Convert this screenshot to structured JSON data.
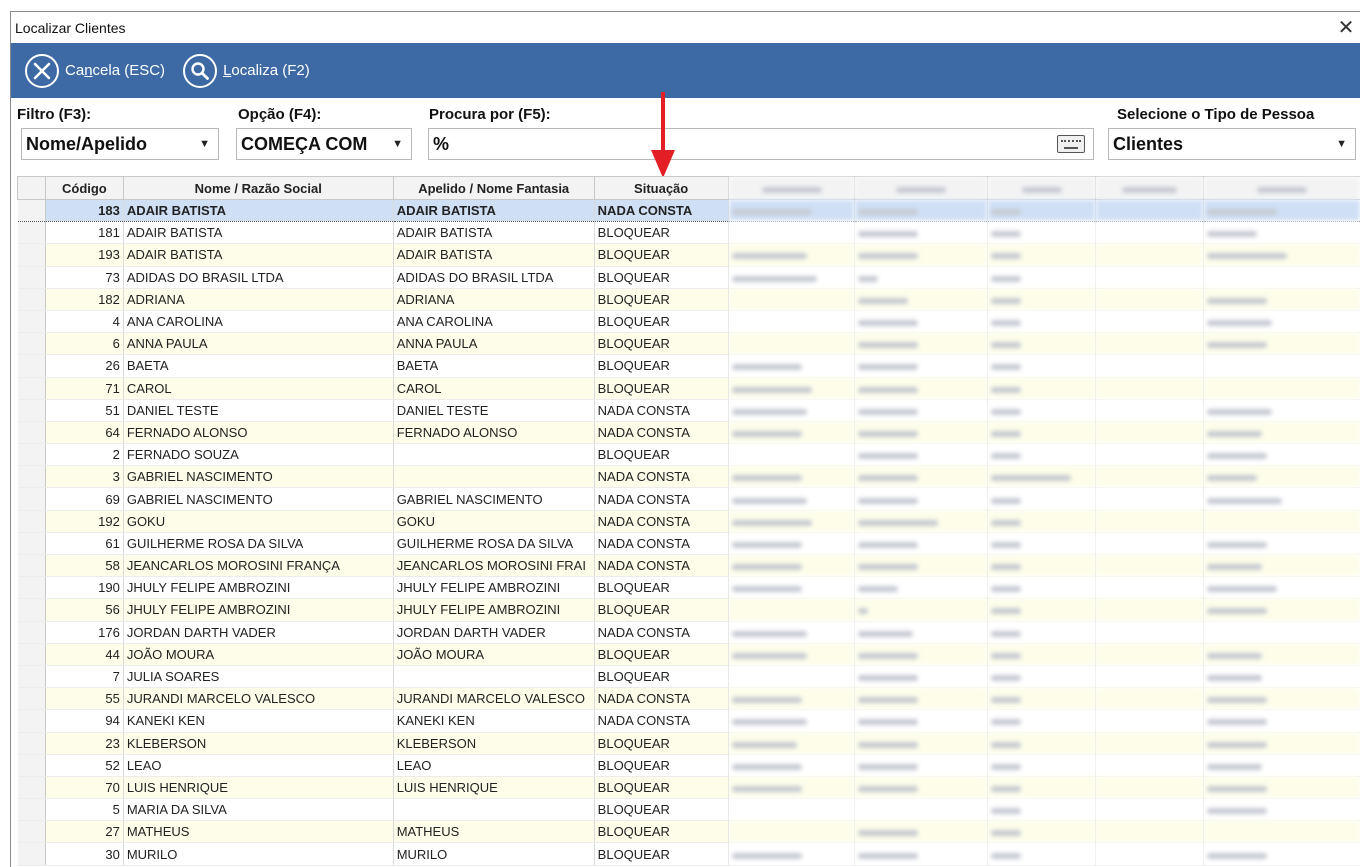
{
  "window": {
    "title": "Localizar Clientes",
    "close_symbol": "✕"
  },
  "toolbar": {
    "cancel": {
      "pre": "Ca",
      "ul": "n",
      "post": "cela (ESC)"
    },
    "search": {
      "pre": "",
      "ul": "L",
      "post": "ocaliza (F2)"
    }
  },
  "filters": {
    "filtro_label": "Filtro (F3):",
    "filtro_value": "Nome/Apelido",
    "opcao_label": "Opção (F4):",
    "opcao_value": "COMEÇA COM",
    "procura_label": "Procura por (F5):",
    "procura_value": "%",
    "tipo_label": "Selecione o Tipo de Pessoa",
    "tipo_value": "Clientes"
  },
  "grid": {
    "columns": [
      "Código",
      "Nome / Razão Social",
      "Apelido / Nome Fantasia",
      "Situação"
    ],
    "rows": [
      {
        "codigo": "183",
        "nome": "ADAIR  BATISTA",
        "apelido": "ADAIR  BATISTA",
        "situacao": "NADA CONSTA"
      },
      {
        "codigo": "181",
        "nome": "ADAIR  BATISTA",
        "apelido": "ADAIR  BATISTA",
        "situacao": "BLOQUEAR"
      },
      {
        "codigo": "193",
        "nome": "ADAIR  BATISTA",
        "apelido": "ADAIR  BATISTA",
        "situacao": "BLOQUEAR"
      },
      {
        "codigo": "73",
        "nome": "ADIDAS DO BRASIL LTDA",
        "apelido": "ADIDAS DO BRASIL LTDA",
        "situacao": "BLOQUEAR"
      },
      {
        "codigo": "182",
        "nome": "ADRIANA",
        "apelido": "ADRIANA",
        "situacao": "BLOQUEAR"
      },
      {
        "codigo": "4",
        "nome": "ANA CAROLINA",
        "apelido": "ANA CAROLINA",
        "situacao": "BLOQUEAR"
      },
      {
        "codigo": "6",
        "nome": "ANNA PAULA",
        "apelido": "ANNA PAULA",
        "situacao": "BLOQUEAR"
      },
      {
        "codigo": "26",
        "nome": "BAETA",
        "apelido": "BAETA",
        "situacao": "BLOQUEAR"
      },
      {
        "codigo": "71",
        "nome": "CAROL",
        "apelido": "CAROL",
        "situacao": "BLOQUEAR"
      },
      {
        "codigo": "51",
        "nome": "DANIEL TESTE",
        "apelido": "DANIEL TESTE",
        "situacao": "NADA CONSTA"
      },
      {
        "codigo": "64",
        "nome": "FERNADO ALONSO",
        "apelido": "FERNADO ALONSO",
        "situacao": "NADA CONSTA"
      },
      {
        "codigo": "2",
        "nome": "FERNADO SOUZA",
        "apelido": "",
        "situacao": "BLOQUEAR"
      },
      {
        "codigo": "3",
        "nome": "GABRIEL NASCIMENTO",
        "apelido": "",
        "situacao": "NADA CONSTA"
      },
      {
        "codigo": "69",
        "nome": "GABRIEL NASCIMENTO",
        "apelido": "GABRIEL NASCIMENTO",
        "situacao": "NADA CONSTA"
      },
      {
        "codigo": "192",
        "nome": "GOKU",
        "apelido": "GOKU",
        "situacao": "NADA CONSTA"
      },
      {
        "codigo": "61",
        "nome": "GUILHERME ROSA DA SILVA",
        "apelido": "GUILHERME ROSA DA SILVA",
        "situacao": "NADA CONSTA"
      },
      {
        "codigo": "58",
        "nome": "JEANCARLOS MOROSINI FRANÇA",
        "apelido": "JEANCARLOS MOROSINI FRAI",
        "situacao": "NADA CONSTA"
      },
      {
        "codigo": "190",
        "nome": "JHULY FELIPE AMBROZINI",
        "apelido": "JHULY FELIPE AMBROZINI",
        "situacao": "BLOQUEAR"
      },
      {
        "codigo": "56",
        "nome": "JHULY FELIPE AMBROZINI",
        "apelido": "JHULY FELIPE AMBROZINI",
        "situacao": "BLOQUEAR"
      },
      {
        "codigo": "176",
        "nome": "JORDAN DARTH VADER",
        "apelido": "JORDAN DARTH VADER",
        "situacao": "NADA CONSTA"
      },
      {
        "codigo": "44",
        "nome": "JOÃO MOURA",
        "apelido": "JOÃO MOURA",
        "situacao": "BLOQUEAR"
      },
      {
        "codigo": "7",
        "nome": "JULIA SOARES",
        "apelido": "",
        "situacao": "BLOQUEAR"
      },
      {
        "codigo": "55",
        "nome": "JURANDI MARCELO VALESCO",
        "apelido": "JURANDI MARCELO VALESCO",
        "situacao": "NADA CONSTA"
      },
      {
        "codigo": "94",
        "nome": "KANEKI KEN",
        "apelido": "KANEKI KEN",
        "situacao": "NADA CONSTA"
      },
      {
        "codigo": "23",
        "nome": "KLEBERSON",
        "apelido": "KLEBERSON",
        "situacao": "BLOQUEAR"
      },
      {
        "codigo": "52",
        "nome": "LEAO",
        "apelido": "LEAO",
        "situacao": "BLOQUEAR"
      },
      {
        "codigo": "70",
        "nome": "LUIS HENRIQUE",
        "apelido": "LUIS HENRIQUE",
        "situacao": "BLOQUEAR"
      },
      {
        "codigo": "5",
        "nome": "MARIA DA SILVA",
        "apelido": "",
        "situacao": "BLOQUEAR"
      },
      {
        "codigo": "27",
        "nome": "MATHEUS",
        "apelido": "MATHEUS",
        "situacao": "BLOQUEAR"
      },
      {
        "codigo": "30",
        "nome": "MURILO",
        "apelido": "MURILO",
        "situacao": "BLOQUEAR"
      }
    ]
  },
  "colors": {
    "toolbar": "#3d6aa4",
    "selected_row": "#cfe0f5",
    "odd_row": "#fdfde9",
    "annotation_arrow": "#e31e24"
  },
  "icons": {
    "cancel": "cancel-circle-x-icon",
    "search": "magnifier-icon",
    "keyboard": "keyboard-icon",
    "close": "close-icon",
    "dropdown": "chevron-down-icon"
  }
}
